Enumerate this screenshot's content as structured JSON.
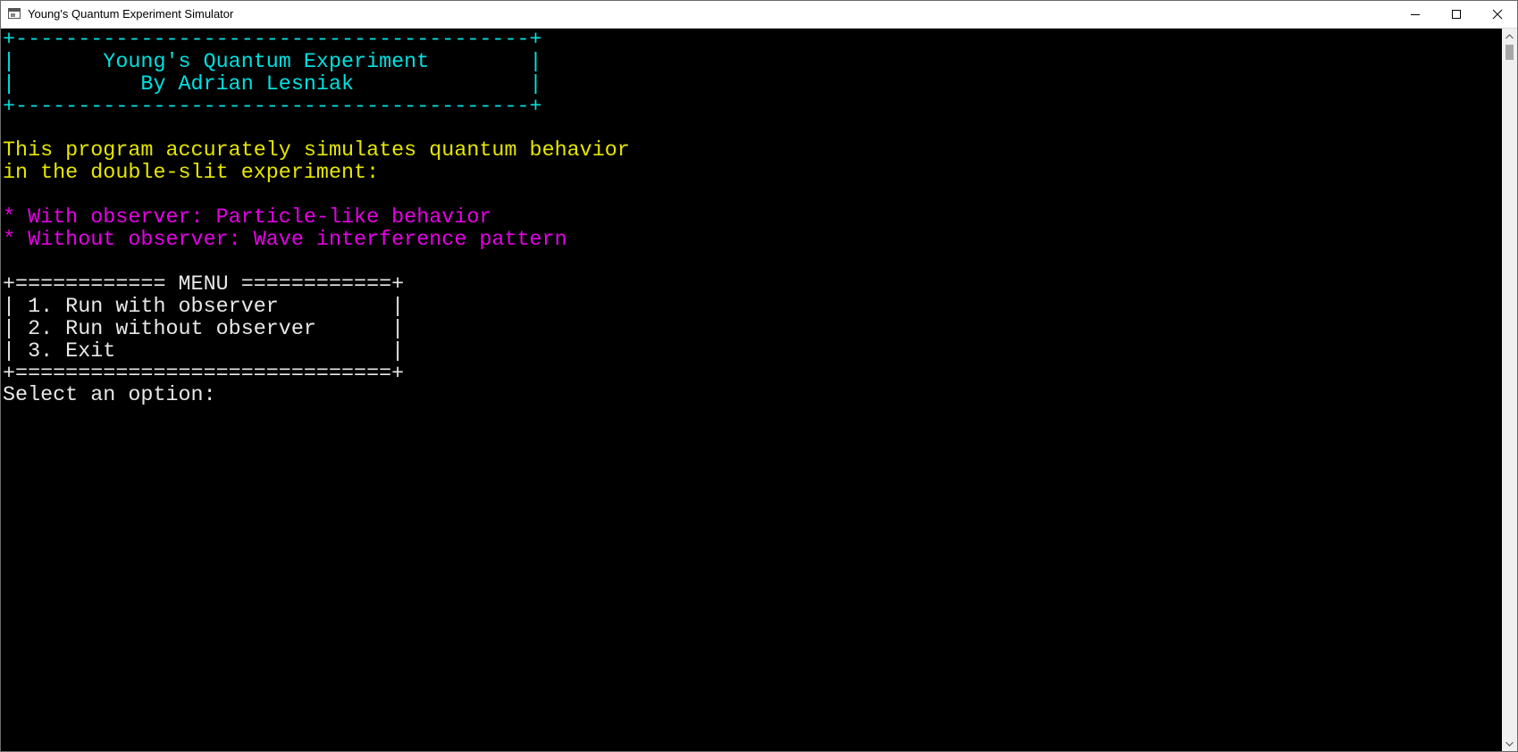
{
  "window": {
    "title": "Young's Quantum Experiment Simulator",
    "icon": "console-app-icon"
  },
  "controls": {
    "minimize_icon": "minimize-icon",
    "maximize_icon": "maximize-icon",
    "close_icon": "close-icon"
  },
  "console": {
    "header": [
      "+-----------------------------------------+",
      "|       Young's Quantum Experiment        |",
      "|          By Adrian Lesniak              |",
      "+-----------------------------------------+"
    ],
    "intro": [
      "This program accurately simulates quantum behavior",
      "in the double-slit experiment:"
    ],
    "bullets": [
      "* With observer: Particle-like behavior",
      "* Without observer: Wave interference pattern"
    ],
    "menu": [
      "+============ MENU ============+",
      "| 1. Run with observer         |",
      "| 2. Run without observer      |",
      "| 3. Exit                      |",
      "+==============================+"
    ],
    "prompt": "Select an option: "
  },
  "colors": {
    "background": "#000000",
    "header": "#00e0e0",
    "intro": "#e6e600",
    "bullets": "#e500e5",
    "menu": "#e8e8e8"
  }
}
